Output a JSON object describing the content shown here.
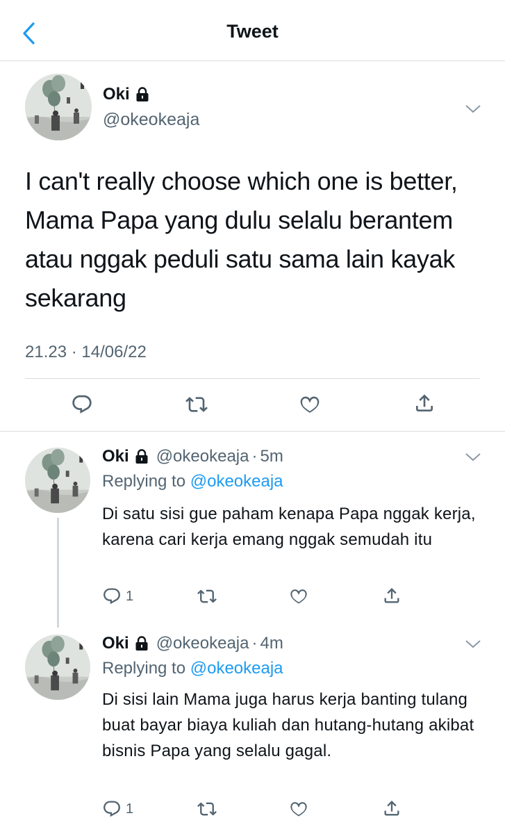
{
  "header": {
    "title": "Tweet"
  },
  "main_tweet": {
    "name": "Oki",
    "handle": "@okeokeaja",
    "text": "I can't really choose which one is better, Mama Papa yang dulu selalu berantem atau nggak peduli satu sama lain kayak sekarang",
    "timestamp": "21.23 · 14/06/22"
  },
  "replies": [
    {
      "name": "Oki",
      "handle": "@okeokeaja",
      "separator": "·",
      "time": "5m",
      "replying_prefix": "Replying to",
      "replying_to": "@okeokeaja",
      "text": "Di satu sisi gue paham kenapa Papa nggak kerja, karena cari kerja emang nggak semudah itu",
      "reply_count": "1"
    },
    {
      "name": "Oki",
      "handle": "@okeokeaja",
      "separator": "·",
      "time": "4m",
      "replying_prefix": "Replying to",
      "replying_to": "@okeokeaja",
      "text": "Di sisi lain Mama juga harus kerja banting tulang buat bayar biaya kuliah dan hutang-hutang akibat bisnis Papa yang selalu gagal.",
      "reply_count": "1"
    }
  ],
  "colors": {
    "accent": "#1d9bf0",
    "secondary_text": "#536471",
    "divider": "#dcdcdc"
  },
  "icons": [
    "back-chevron-icon",
    "lock-icon",
    "chevron-down-icon",
    "reply-icon",
    "retweet-icon",
    "like-icon",
    "share-icon"
  ]
}
